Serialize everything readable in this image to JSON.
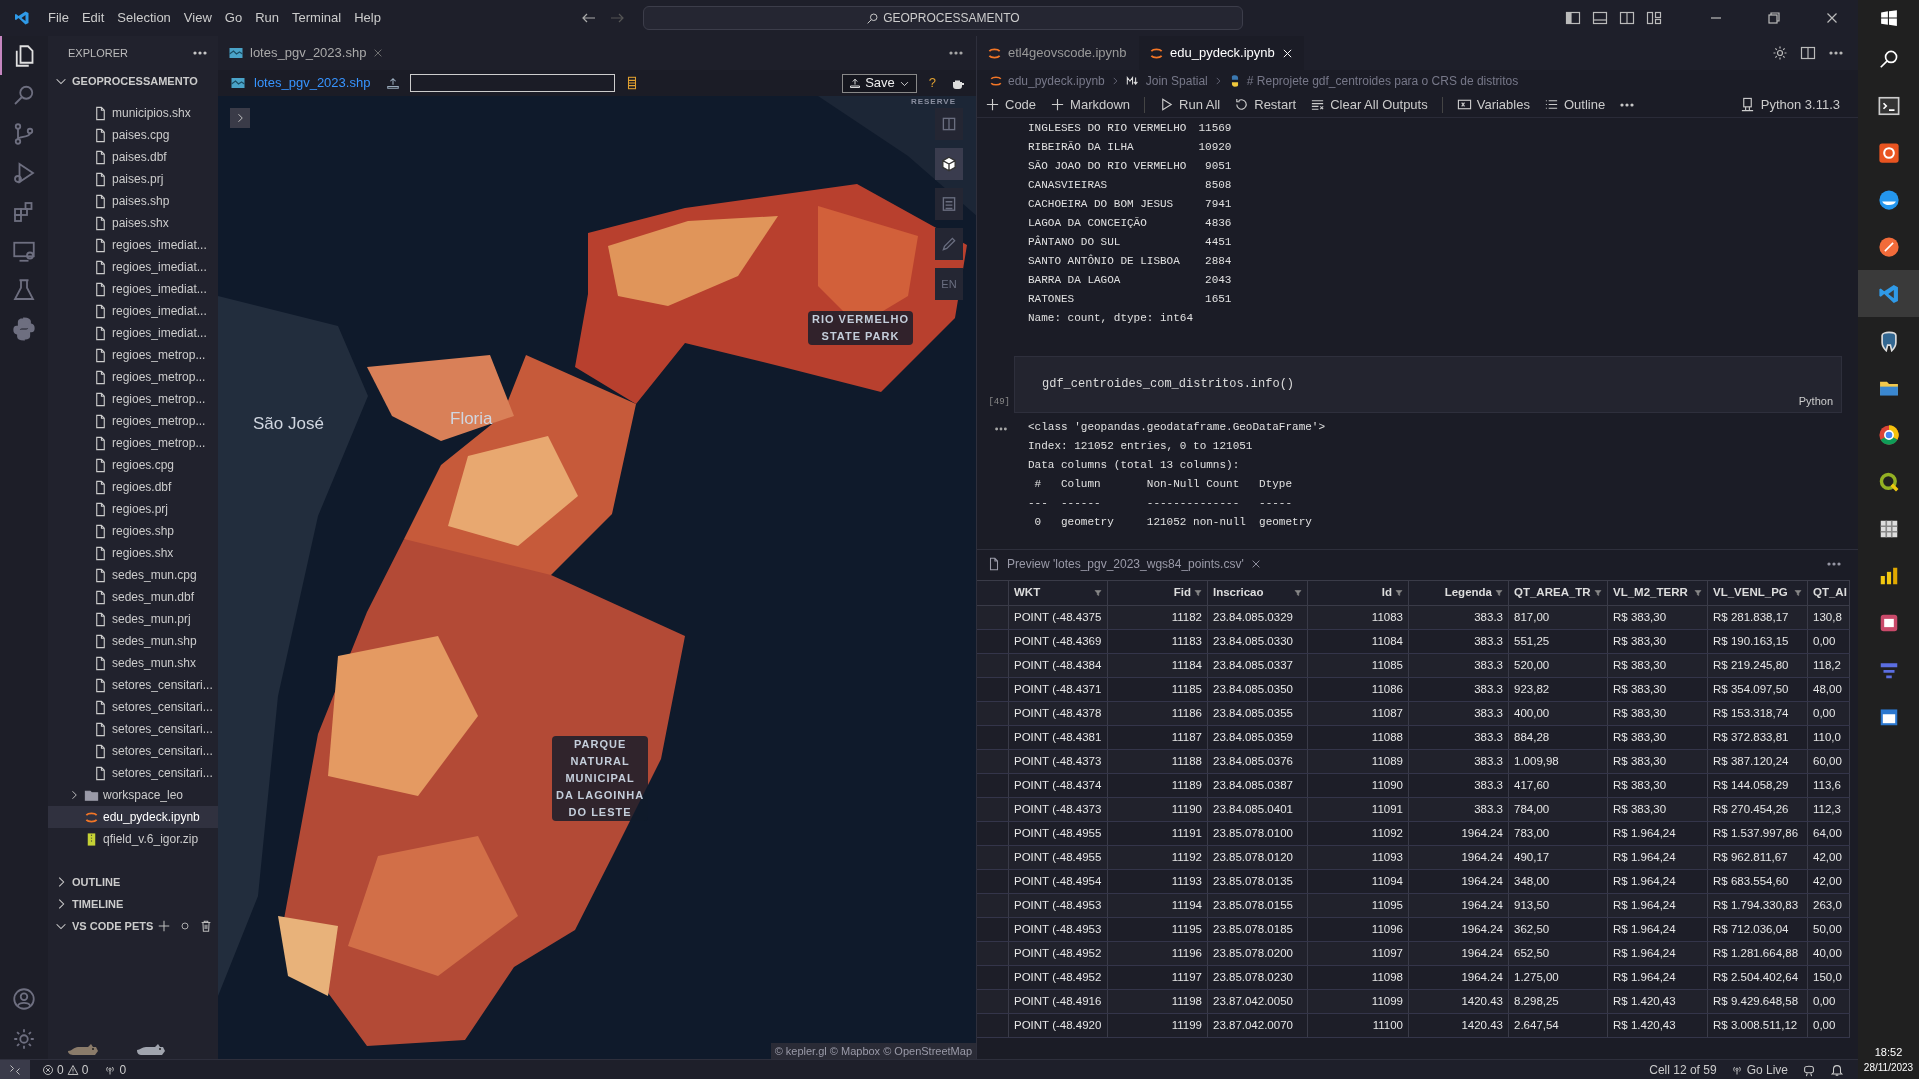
{
  "title_bar": {
    "menu": [
      "File",
      "Edit",
      "Selection",
      "View",
      "Go",
      "Run",
      "Terminal",
      "Help"
    ],
    "search": "GEOPROCESSAMENTO"
  },
  "activity_bar": {
    "items": [
      {
        "selected": true
      },
      {
        "selected": false
      },
      {
        "selected": false
      },
      {
        "selected": false
      },
      {
        "selected": false
      },
      {
        "selected": false
      },
      {
        "selected": false
      },
      {
        "selected": false
      }
    ]
  },
  "sidebar": {
    "title": "EXPLORER",
    "root": "GEOPROCESSAMENTO",
    "items": [
      {
        "children": [
          {
            "label": "municipios.shx",
            "kind": "file",
            "selected": false
          },
          {
            "label": "paises.cpg",
            "kind": "file",
            "selected": false
          },
          {
            "label": "paises.dbf",
            "kind": "file",
            "selected": false
          },
          {
            "label": "paises.prj",
            "kind": "file",
            "selected": false
          },
          {
            "label": "paises.shp",
            "kind": "file",
            "selected": false
          },
          {
            "label": "paises.shx",
            "kind": "file",
            "selected": false
          },
          {
            "label": "regioes_imediat...",
            "kind": "file",
            "selected": false
          },
          {
            "label": "regioes_imediat...",
            "kind": "file",
            "selected": false
          },
          {
            "label": "regioes_imediat...",
            "kind": "file",
            "selected": false
          },
          {
            "label": "regioes_imediat...",
            "kind": "file",
            "selected": false
          },
          {
            "label": "regioes_imediat...",
            "kind": "file",
            "selected": false
          },
          {
            "label": "regioes_metrop...",
            "kind": "file",
            "selected": false
          },
          {
            "label": "regioes_metrop...",
            "kind": "file",
            "selected": false
          },
          {
            "label": "regioes_metrop...",
            "kind": "file",
            "selected": false
          },
          {
            "label": "regioes_metrop...",
            "kind": "file",
            "selected": false
          },
          {
            "label": "regioes_metrop...",
            "kind": "file",
            "selected": false
          },
          {
            "label": "regioes.cpg",
            "kind": "file",
            "selected": false
          },
          {
            "label": "regioes.dbf",
            "kind": "file",
            "selected": false
          },
          {
            "label": "regioes.prj",
            "kind": "file",
            "selected": false
          },
          {
            "label": "regioes.shp",
            "kind": "file",
            "selected": false
          },
          {
            "label": "regioes.shx",
            "kind": "file",
            "selected": false
          },
          {
            "label": "sedes_mun.cpg",
            "kind": "file",
            "selected": false
          },
          {
            "label": "sedes_mun.dbf",
            "kind": "file",
            "selected": false
          },
          {
            "label": "sedes_mun.prj",
            "kind": "file",
            "selected": false
          },
          {
            "label": "sedes_mun.shp",
            "kind": "file",
            "selected": false
          },
          {
            "label": "sedes_mun.shx",
            "kind": "file",
            "selected": false
          },
          {
            "label": "setores_censitari...",
            "kind": "file",
            "selected": false
          },
          {
            "label": "setores_censitari...",
            "kind": "file",
            "selected": false
          },
          {
            "label": "setores_censitari...",
            "kind": "file",
            "selected": false
          },
          {
            "label": "setores_censitari...",
            "kind": "file",
            "selected": false
          },
          {
            "label": "setores_censitari...",
            "kind": "file",
            "selected": false
          }
        ]
      },
      {
        "label": "workspace_leo",
        "kind": "folder",
        "selected": false
      },
      {
        "label": "edu_pydeck.ipynb",
        "kind": "notebook",
        "selected": true
      },
      {
        "label": "qfield_v.6_igor.zip",
        "kind": "zip",
        "selected": false
      }
    ],
    "sections": [
      {
        "label": "OUTLINE",
        "expanded": false
      },
      {
        "label": "TIMELINE",
        "expanded": false
      },
      {
        "label": "VS CODE PETS",
        "expanded": true
      }
    ]
  },
  "map_editor": {
    "tab": "lotes_pgv_2023.shp",
    "file_link": "lotes_pgv_2023.shp",
    "save": "Save",
    "help": "?",
    "map": {
      "reserve": "RESERVE",
      "labels": [
        {
          "text": "São José",
          "kind": "city"
        },
        {
          "text": "Floria",
          "kind": "city"
        },
        {
          "text": "RIO VERMELHO\nSTATE PARK",
          "kind": "park"
        },
        {
          "text": "PARQUE\nNATURAL\nMUNICIPAL\nDA LAGOINHA\nDO LESTE",
          "kind": "park"
        }
      ],
      "controls": [
        {
          "selected": false
        },
        {
          "selected": true
        },
        {
          "selected": false
        },
        {
          "selected": false
        },
        {
          "selected": false,
          "label": "EN"
        }
      ],
      "attribution": "© kepler.gl © Mapbox © OpenStreetMap"
    }
  },
  "notebook": {
    "tabs": [
      {
        "label": "etl4geovscode.ipynb",
        "selected": false
      },
      {
        "label": "edu_pydeck.ipynb",
        "selected": true
      }
    ],
    "breadcrumb": [
      "edu_pydeck.ipynb",
      "Join Spatial",
      "# Reprojete gdf_centroides para o CRS de distritos"
    ],
    "toolbar": [
      "Code",
      "Markdown",
      "Run All",
      "Restart",
      "Clear All Outputs",
      "Variables",
      "Outline"
    ],
    "kernel": "Python 3.11.3",
    "output_rows": [
      {
        "name": "INGLESES DO RIO VERMELHO",
        "count": "11569"
      },
      {
        "name": "RIBEIRÃO DA ILHA",
        "count": "10920"
      },
      {
        "name": "SÃO JOAO DO RIO VERMELHO",
        "count": "9051"
      },
      {
        "name": "CANASVIEIRAS",
        "count": "8508"
      },
      {
        "name": "CACHOEIRA DO BOM JESUS",
        "count": "7941"
      },
      {
        "name": "LAGOA DA CONCEIÇÃO",
        "count": "4836"
      },
      {
        "name": "PÂNTANO DO SUL",
        "count": "4451"
      },
      {
        "name": "SANTO ANTÔNIO DE LISBOA",
        "count": "2884"
      },
      {
        "name": "BARRA DA LAGOA",
        "count": "2043"
      },
      {
        "name": "RATONES",
        "count": "1651"
      }
    ],
    "output_footer": "Name: count, dtype: int64",
    "cell": {
      "code": "gdf_centroides_com_distritos.info()",
      "count": "[49]",
      "language": "Python"
    },
    "info_lines": [
      "<class 'geopandas.geodataframe.GeoDataFrame'>",
      "Index: 121052 entries, 0 to 121051",
      "Data columns (total 13 columns):",
      " #   Column       Non-Null Count   Dtype",
      "---  ------       --------------   -----",
      " 0   geometry     121052 non-null  geometry"
    ]
  },
  "preview": {
    "title": "Preview 'lotes_pgv_2023_wgs84_points.csv'",
    "columns": [
      "WKT",
      "Fid",
      "Inscricao",
      "Id",
      "Legenda",
      "QT_AREA_TR",
      "VL_M2_TERR",
      "VL_VENL_PG",
      "QT_AI"
    ],
    "rows": [
      [
        "POINT (-48.4375",
        "11182",
        "23.84.085.0329",
        "11083",
        "383.3",
        "817,00",
        "R$ 383,30",
        "R$ 281.838,17",
        "130,8"
      ],
      [
        "POINT (-48.4369",
        "11183",
        "23.84.085.0330",
        "11084",
        "383.3",
        "551,25",
        "R$ 383,30",
        "R$ 190.163,15",
        "0,00"
      ],
      [
        "POINT (-48.4384",
        "11184",
        "23.84.085.0337",
        "11085",
        "383.3",
        "520,00",
        "R$ 383,30",
        "R$ 219.245,80",
        "118,2"
      ],
      [
        "POINT (-48.4371",
        "11185",
        "23.84.085.0350",
        "11086",
        "383.3",
        "923,82",
        "R$ 383,30",
        "R$ 354.097,50",
        "48,00"
      ],
      [
        "POINT (-48.4378",
        "11186",
        "23.84.085.0355",
        "11087",
        "383.3",
        "400,00",
        "R$ 383,30",
        "R$ 153.318,74",
        "0,00"
      ],
      [
        "POINT (-48.4381",
        "11187",
        "23.84.085.0359",
        "11088",
        "383.3",
        "884,28",
        "R$ 383,30",
        "R$ 372.833,81",
        "110,0"
      ],
      [
        "POINT (-48.4373",
        "11188",
        "23.84.085.0376",
        "11089",
        "383.3",
        "1.009,98",
        "R$ 383,30",
        "R$ 387.120,24",
        "60,00"
      ],
      [
        "POINT (-48.4374",
        "11189",
        "23.84.085.0387",
        "11090",
        "383.3",
        "417,60",
        "R$ 383,30",
        "R$ 144.058,29",
        "113,6"
      ],
      [
        "POINT (-48.4373",
        "11190",
        "23.84.085.0401",
        "11091",
        "383.3",
        "784,00",
        "R$ 383,30",
        "R$ 270.454,26",
        "112,3"
      ],
      [
        "POINT (-48.4955",
        "11191",
        "23.85.078.0100",
        "11092",
        "1964.24",
        "783,00",
        "R$ 1.964,24",
        "R$ 1.537.997,86",
        "64,00"
      ],
      [
        "POINT (-48.4955",
        "11192",
        "23.85.078.0120",
        "11093",
        "1964.24",
        "490,17",
        "R$ 1.964,24",
        "R$ 962.811,67",
        "42,00"
      ],
      [
        "POINT (-48.4954",
        "11193",
        "23.85.078.0135",
        "11094",
        "1964.24",
        "348,00",
        "R$ 1.964,24",
        "R$ 683.554,60",
        "42,00"
      ],
      [
        "POINT (-48.4953",
        "11194",
        "23.85.078.0155",
        "11095",
        "1964.24",
        "913,50",
        "R$ 1.964,24",
        "R$ 1.794.330,83",
        "263,0"
      ],
      [
        "POINT (-48.4953",
        "11195",
        "23.85.078.0185",
        "11096",
        "1964.24",
        "362,50",
        "R$ 1.964,24",
        "R$ 712.036,04",
        "50,00"
      ],
      [
        "POINT (-48.4952",
        "11196",
        "23.85.078.0200",
        "11097",
        "1964.24",
        "652,50",
        "R$ 1.964,24",
        "R$ 1.281.664,88",
        "40,00"
      ],
      [
        "POINT (-48.4952",
        "11197",
        "23.85.078.0230",
        "11098",
        "1964.24",
        "1.275,00",
        "R$ 1.964,24",
        "R$ 2.504.402,64",
        "150,0"
      ],
      [
        "POINT (-48.4916",
        "11198",
        "23.87.042.0050",
        "11099",
        "1420.43",
        "8.298,25",
        "R$ 1.420,43",
        "R$ 9.429.648,58",
        "0,00"
      ],
      [
        "POINT (-48.4920",
        "11199",
        "23.87.042.0070",
        "11100",
        "1420.43",
        "2.647,54",
        "R$ 1.420,43",
        "R$ 3.008.511,12",
        "0,00"
      ]
    ]
  },
  "status_bar": {
    "errors": "0",
    "warnings": "0",
    "ports": "0",
    "cell": "Cell 12 of 59",
    "go_live": "Go Live"
  },
  "taskbar": {
    "items": [
      {
        "selected": false
      },
      {
        "selected": false
      },
      {
        "selected": false
      },
      {
        "selected": false
      },
      {
        "selected": true
      },
      {
        "selected": false
      },
      {
        "selected": false
      },
      {
        "selected": false
      },
      {
        "selected": false
      },
      {
        "selected": false
      },
      {
        "selected": false
      },
      {
        "selected": false
      },
      {
        "selected": false
      },
      {
        "selected": false
      }
    ],
    "time": "18:52",
    "date": "28/11/2023"
  }
}
